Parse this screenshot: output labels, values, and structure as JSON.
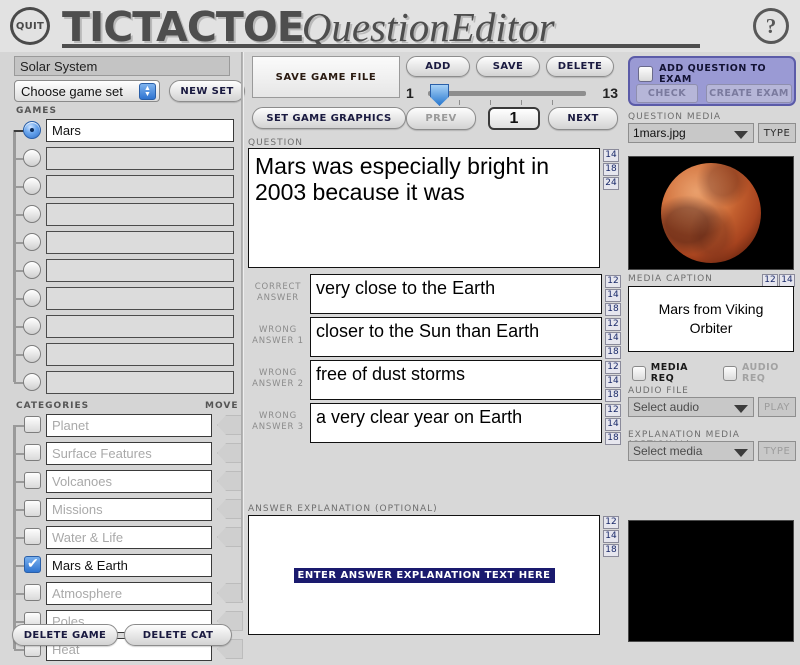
{
  "header": {
    "quit_label": "QUIT",
    "title_main": "TICTACTOE",
    "title_sub": "QuestionEditor",
    "help_label": "?"
  },
  "sidebar": {
    "set_name": "Solar System",
    "game_set_select": "Choose game set",
    "new_set_label": "NEW SET",
    "games_label": "GAMES",
    "categories_label": "CATEGORIES",
    "move_label": "MOVE",
    "games": [
      {
        "label": "Mars",
        "selected": true
      },
      {
        "label": "",
        "selected": false
      },
      {
        "label": "",
        "selected": false
      },
      {
        "label": "",
        "selected": false
      },
      {
        "label": "",
        "selected": false
      },
      {
        "label": "",
        "selected": false
      },
      {
        "label": "",
        "selected": false
      },
      {
        "label": "",
        "selected": false
      },
      {
        "label": "",
        "selected": false
      },
      {
        "label": "",
        "selected": false
      }
    ],
    "categories": [
      {
        "label": "Planet",
        "checked": false
      },
      {
        "label": "Surface Features",
        "checked": false
      },
      {
        "label": "Volcanoes",
        "checked": false
      },
      {
        "label": "Missions",
        "checked": false
      },
      {
        "label": "Water & Life",
        "checked": false
      },
      {
        "label": "Mars & Earth",
        "checked": true
      },
      {
        "label": "Atmosphere",
        "checked": false
      },
      {
        "label": "Poles",
        "checked": false
      },
      {
        "label": "Heat",
        "checked": false
      }
    ],
    "delete_game_label": "DELETE GAME",
    "delete_cat_label": "DELETE CAT"
  },
  "center": {
    "save_game_file_label": "SAVE GAME FILE",
    "set_game_graphics_label": "SET GAME GRAPHICS",
    "add_label": "ADD",
    "save_label": "SAVE",
    "delete_label": "DELETE",
    "slider_min": "1",
    "slider_max": "13",
    "prev_label": "PREV",
    "next_label": "NEXT",
    "question_number": "1",
    "question_label": "QUESTION",
    "question_text": "Mars was especially bright in 2003 because it was",
    "question_sizes": [
      "14",
      "18",
      "24"
    ],
    "answer_sizes": [
      "12",
      "14",
      "18"
    ],
    "answers": [
      {
        "label": "CORRECT ANSWER",
        "text": "very close to the Earth"
      },
      {
        "label": "WRONG ANSWER 1",
        "text": "closer to the Sun than Earth"
      },
      {
        "label": "WRONG ANSWER 2",
        "text": "free of dust storms"
      },
      {
        "label": "WRONG ANSWER 3",
        "text": "a very clear year on Earth"
      }
    ],
    "explanation_label": "ANSWER EXPLANATION (OPTIONAL)",
    "explanation_placeholder": "ENTER ANSWER EXPLANATION TEXT HERE",
    "explanation_sizes": [
      "12",
      "14",
      "18"
    ]
  },
  "right": {
    "add_to_exam_label": "ADD QUESTION TO EXAM",
    "check_label": "CHECK",
    "create_exam_label": "CREATE EXAM",
    "question_media_label": "QUESTION MEDIA",
    "question_media_value": "1mars.jpg",
    "type_label": "TYPE",
    "media_caption_label": "MEDIA CAPTION",
    "media_caption_sizes": [
      "12",
      "14"
    ],
    "media_caption_text": "Mars from Viking Orbiter",
    "media_req_label": "MEDIA REQ",
    "audio_req_label": "AUDIO REQ",
    "audio_file_label": "AUDIO FILE",
    "audio_file_value": "Select audio",
    "play_label": "PLAY",
    "explanation_media_label": "EXPLANATION MEDIA (OPTIONAL)",
    "explanation_media_value": "Select media",
    "explanation_type_label": "TYPE"
  },
  "colors": {
    "accent_blue": "#2f74d0",
    "exam_panel": "#9a9ad4",
    "highlight_navy": "#1a1a6e",
    "mars_orange": "#cf6c36"
  }
}
